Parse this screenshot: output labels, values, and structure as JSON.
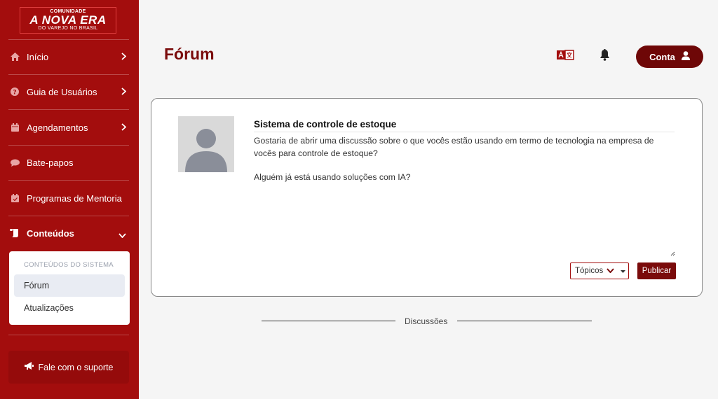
{
  "logo": {
    "line1": "COMUNIDADE",
    "line2": "A NOVA ERA",
    "line3": "DO VAREJO NO BRASIL"
  },
  "sidebar": {
    "items": [
      {
        "label": "Início",
        "icon": "home-icon"
      },
      {
        "label": "Guia de Usuários",
        "icon": "help-circle-icon"
      },
      {
        "label": "Agendamentos",
        "icon": "calendar-icon"
      },
      {
        "label": "Bate-papos",
        "icon": "chat-bubble-icon"
      },
      {
        "label": "Programas de Mentoria",
        "icon": "calendar-check-icon"
      },
      {
        "label": "Conteúdos",
        "icon": "scroll-icon"
      }
    ],
    "submenu": {
      "title": "CONTEÚDOS DO SISTEMA",
      "items": [
        {
          "label": "Fórum"
        },
        {
          "label": "Atualizações"
        }
      ]
    },
    "support_label": "Fale com o suporte"
  },
  "header": {
    "title": "Fórum",
    "account_label": "Conta"
  },
  "post": {
    "title": "Sistema de controle de estoque",
    "body_line1": "Gostaria de abrir uma discussão sobre o que vocês estão usando em termo de tecnologia na empresa de vocês para controle de estoque?",
    "body_line2": "Alguém já está usando soluções com IA?",
    "topics_label": "Tópicos",
    "publish_label": "Publicar"
  },
  "discussions_label": "Discussões",
  "colors": {
    "sidebar": "#a30d0d",
    "accent": "#7a0b0b"
  }
}
